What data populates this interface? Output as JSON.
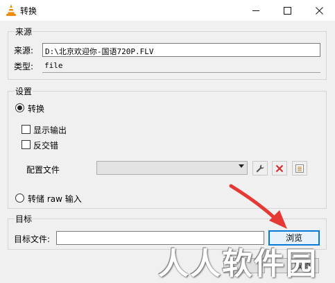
{
  "window": {
    "title": "转换",
    "controls": {
      "minimize": "minimize",
      "maximize": "maximize",
      "close": "close"
    }
  },
  "source": {
    "group_title": "来源",
    "source_label": "来源:",
    "source_value": "D:\\北京欢迎你-国语720P.FLV",
    "type_label": "类型:",
    "type_value": "file"
  },
  "settings": {
    "group_title": "设置",
    "convert_label": "转换",
    "convert_selected": true,
    "show_output_label": "显示输出",
    "show_output_checked": false,
    "deinterlace_label": "反交错",
    "deinterlace_checked": false,
    "profile_label": "配置文件",
    "profile_value": "",
    "dump_raw_label": "转储 raw 输入",
    "dump_raw_selected": false
  },
  "destination": {
    "group_title": "目标",
    "file_label": "目标文件:",
    "file_value": "",
    "browse_label": "浏览"
  },
  "footer": {
    "cancel_partial": "取消"
  },
  "watermark": "人人软件园",
  "colors": {
    "accent": "#0078d7",
    "arrow": "#e53935",
    "delete": "#d32f2f"
  }
}
